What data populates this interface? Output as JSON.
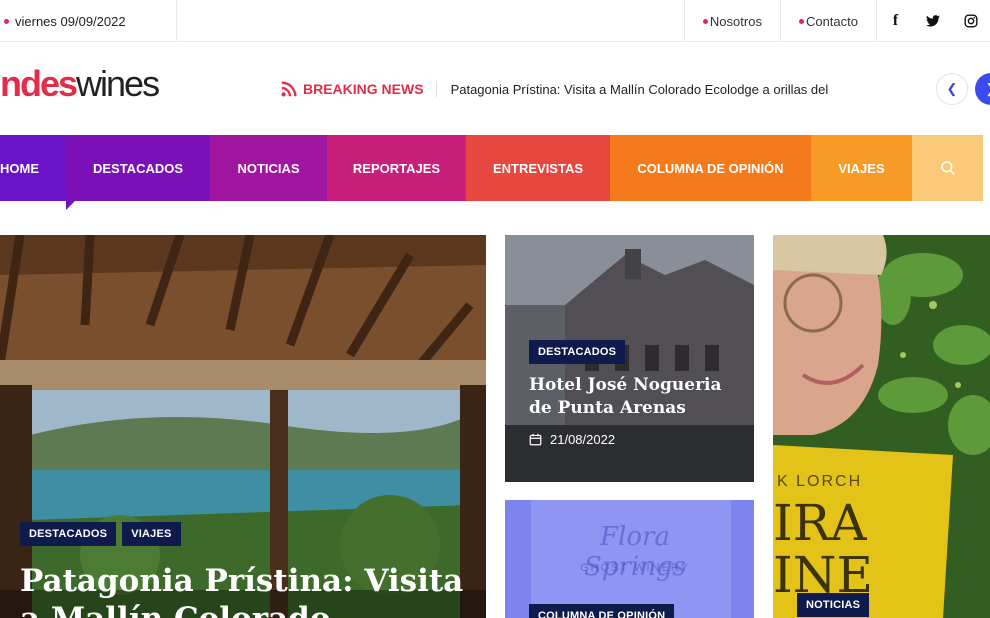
{
  "topbar": {
    "date": "viernes 09/09/2022",
    "links": [
      "Nosotros",
      "Contacto"
    ],
    "social": [
      {
        "icon": "facebook-icon",
        "glyph": "f"
      },
      {
        "icon": "twitter-icon",
        "glyph": "🐦"
      },
      {
        "icon": "instagram-icon",
        "glyph": "◎"
      }
    ]
  },
  "header": {
    "logo_part1": "ndes",
    "logo_part2": "wines",
    "breaking_label": "BREAKING NEWS",
    "breaking_text": "Patagonia Prístina: Visita a Mallín Colorado Ecolodge a orillas del",
    "prev_glyph": "❮",
    "next_glyph": "❯"
  },
  "nav": {
    "items": [
      {
        "label": "HOME",
        "color": "#6a13c9"
      },
      {
        "label": "DESTACADOS",
        "color": "#7a10b6"
      },
      {
        "label": "NOTICIAS",
        "color": "#a016a1"
      },
      {
        "label": "REPORTAJES",
        "color": "#c81f7a"
      },
      {
        "label": "ENTREVISTAS",
        "color": "#e6473f"
      },
      {
        "label": "COLUMNA DE OPINIÓN",
        "color": "#f47a1b"
      },
      {
        "label": "VIAJES",
        "color": "#f79a26"
      }
    ],
    "search_icon": "search-icon",
    "search_color": "#fbc97a"
  },
  "cards": {
    "big": {
      "tags": [
        "DESTACADOS",
        "VIAJES"
      ],
      "title_line1": "Patagonia Prístina: Visita",
      "title_line2": "a Mallín Colorado"
    },
    "hotel": {
      "tag": "DESTACADOS",
      "title": "Hotel José Nogueria de Punta Arenas",
      "date": "21/08/2022"
    },
    "flora": {
      "tag": "COLUMNA DE OPINIÓN",
      "sign_line1": "Flora Springs",
      "sign_line2": "GHOST WINERY"
    },
    "book": {
      "tag": "NOTICIAS",
      "cover_author": "K LORCH",
      "cover_line1": "IRA",
      "cover_line2": "INE"
    }
  },
  "colors": {
    "accent": "#e22d4a",
    "tag_bg": "#0f1b4d",
    "arrow_blue": "#3b4bf0"
  }
}
